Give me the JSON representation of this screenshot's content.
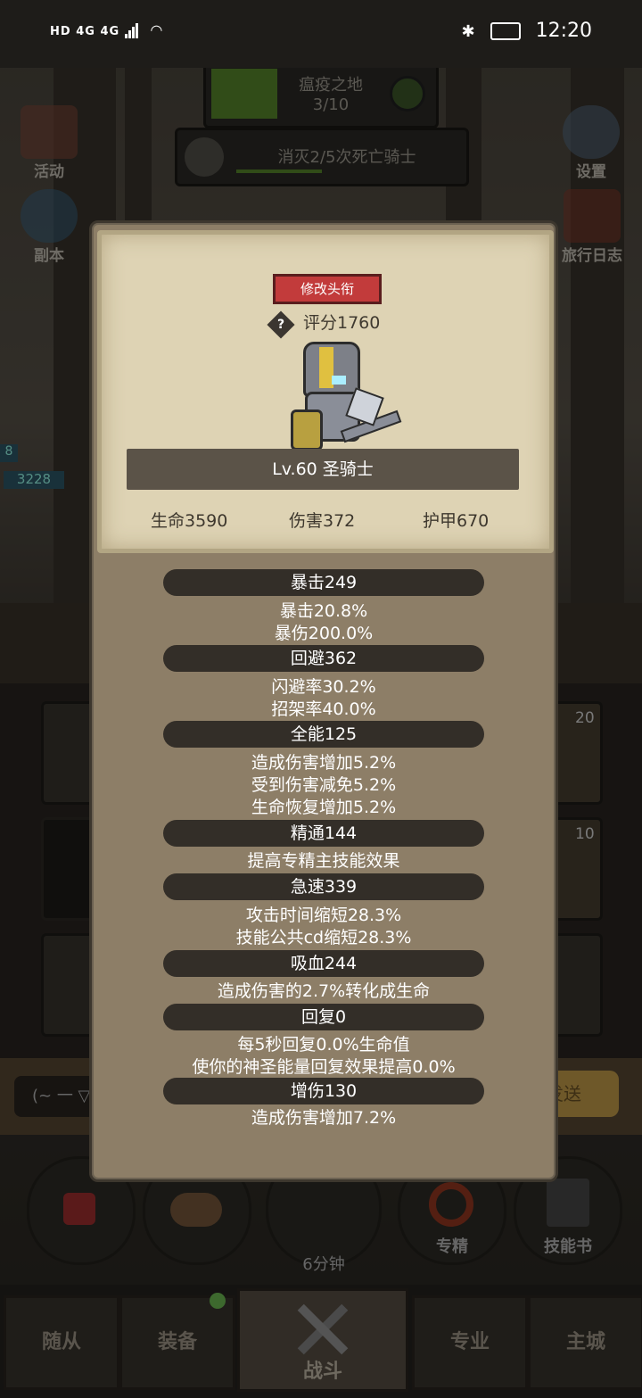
{
  "status_bar": {
    "left_text": "HD 4G 4G",
    "time": "12:20"
  },
  "top_banner": {
    "zone_name": "瘟疫之地",
    "zone_progress": "3/10",
    "quest_text": "消灭2/5次死亡骑士"
  },
  "side_buttons": {
    "events": "活动",
    "dungeon": "副本",
    "settings": "设置",
    "travel_log": "旅行日志"
  },
  "left_values": [
    "8",
    "3228"
  ],
  "dialog": {
    "change_title_button": "修改头衔",
    "score": "评分1760",
    "level_class": "Lv.60 圣骑士",
    "base_stats": [
      "生命3590",
      "伤害372",
      "护甲670"
    ],
    "attributes": [
      {
        "header": "暴击249",
        "lines": [
          "暴击20.8%",
          "暴伤200.0%"
        ]
      },
      {
        "header": "回避362",
        "lines": [
          "闪避率30.2%",
          "招架率40.0%"
        ]
      },
      {
        "header": "全能125",
        "lines": [
          "造成伤害增加5.2%",
          "受到伤害减免5.2%",
          "生命恢复增加5.2%"
        ]
      },
      {
        "header": "精通144",
        "lines": [
          "提高专精主技能效果"
        ]
      },
      {
        "header": "急速339",
        "lines": [
          "攻击时间缩短28.3%",
          "技能公共cd缩短28.3%"
        ]
      },
      {
        "header": "吸血244",
        "lines": [
          "造成伤害的2.7%转化成生命"
        ]
      },
      {
        "header": "回复0",
        "lines": [
          "每5秒回复0.0%生命值",
          "使你的神圣能量回复效果提高0.0%"
        ]
      },
      {
        "header": "增伤130",
        "lines": [
          "造成伤害增加7.2%"
        ]
      }
    ]
  },
  "background_items": {
    "badge_20": "20",
    "badge_10": "10",
    "chat_emote": "(~ 一 ▽",
    "send_label": "发送",
    "timer": "6分钟",
    "specialization": "专精",
    "skill_book": "技能书"
  },
  "bottom_nav": [
    "随从",
    "装备",
    "战斗",
    "专业",
    "主城"
  ],
  "colors": {
    "title_button": "#c23b3b",
    "parchment": "#ded3b4",
    "dialog_bg": "#8d7e67",
    "header_pill": "#332e28"
  }
}
